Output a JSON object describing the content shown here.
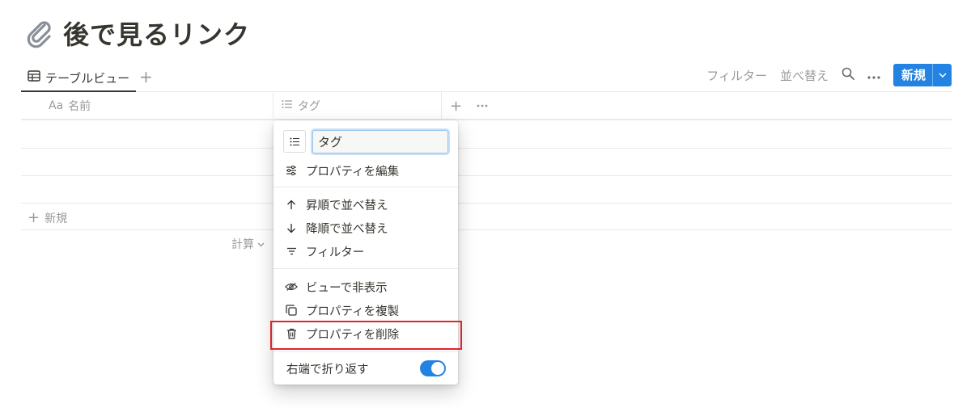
{
  "page": {
    "title": "後で見るリンク",
    "icon": "paperclip-icon"
  },
  "view": {
    "tab_label": "テーブルビュー",
    "add_view_label": "+"
  },
  "toolbar": {
    "filter_label": "フィルター",
    "sort_label": "並べ替え",
    "new_label": "新規"
  },
  "table": {
    "columns": [
      {
        "prefix": "Aa",
        "label": "名前",
        "icon": "text-icon"
      },
      {
        "label": "タグ",
        "icon": "list-icon"
      }
    ],
    "add_column_label": "+",
    "add_row_label": "新規",
    "calc_label": "計算"
  },
  "menu": {
    "property_name_value": "タグ",
    "items": [
      {
        "label": "プロパティを編集",
        "icon": "sliders-icon"
      },
      {
        "label": "昇順で並べ替え",
        "icon": "arrow-up-icon"
      },
      {
        "label": "降順で並べ替え",
        "icon": "arrow-down-icon"
      },
      {
        "label": "フィルター",
        "icon": "filter-icon"
      },
      {
        "label": "ビューで非表示",
        "icon": "eye-off-icon"
      },
      {
        "label": "プロパティを複製",
        "icon": "duplicate-icon"
      },
      {
        "label": "プロパティを削除",
        "icon": "trash-icon"
      }
    ],
    "wrap_label": "右端で折り返す",
    "wrap_enabled": true
  },
  "colors": {
    "accent": "#2383e2",
    "highlight": "#e0242a",
    "text": "#37352f",
    "muted": "#9b9a97"
  }
}
